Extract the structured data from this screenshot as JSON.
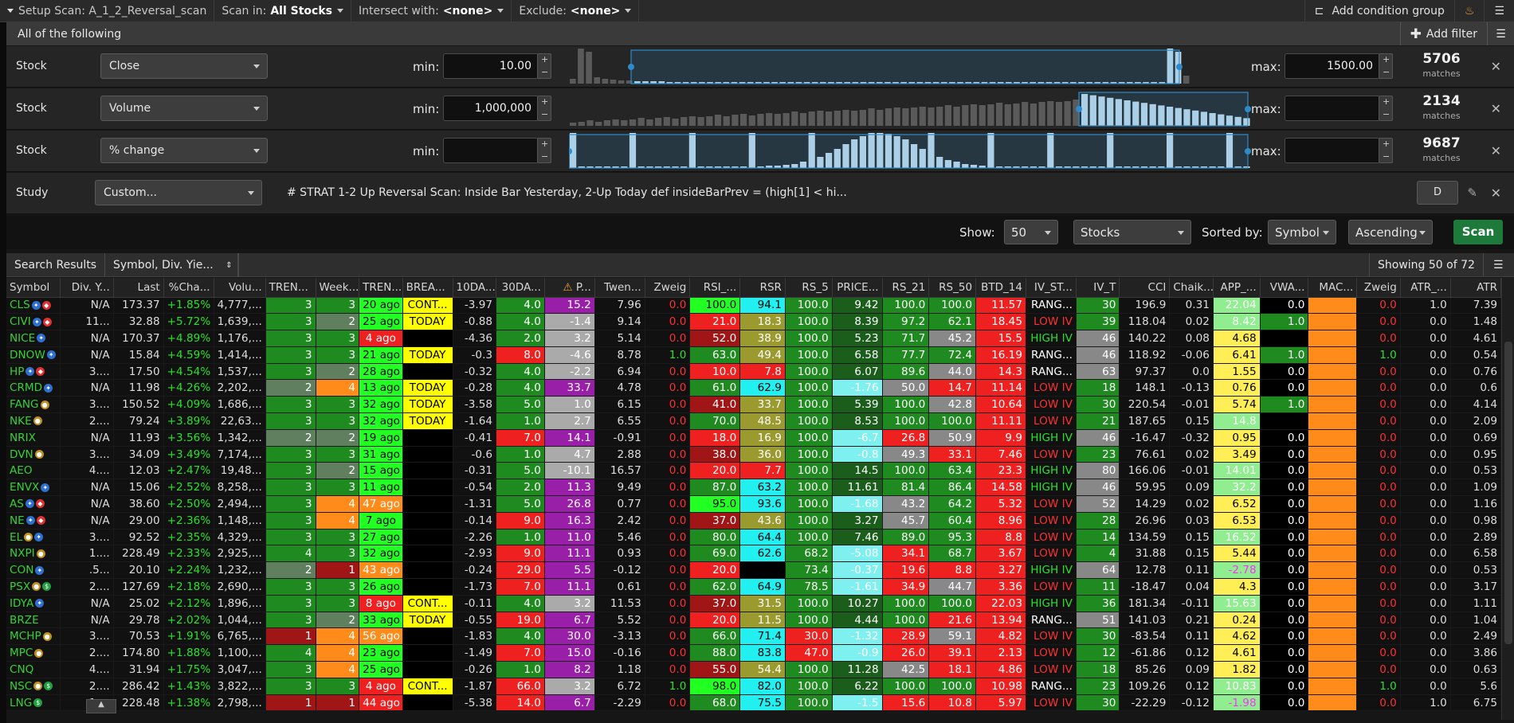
{
  "topbar": {
    "setup_scan": "Setup Scan: A_1_2_Reversal_scan",
    "scan_in_label": "Scan in:",
    "scan_in_value": "All Stocks",
    "intersect_label": "Intersect with:",
    "intersect_value": "<none>",
    "exclude_label": "Exclude:",
    "exclude_value": "<none>",
    "add_condition": "Add condition group"
  },
  "subbar": {
    "title": "All of the following",
    "add_filter": "Add filter"
  },
  "filters": [
    {
      "label": "Stock",
      "field": "Close",
      "min_label": "min:",
      "min": "10.00",
      "max_label": "max:",
      "max": "1500.00",
      "matches": "5706",
      "matches_label": "matches"
    },
    {
      "label": "Stock",
      "field": "Volume",
      "min_label": "min:",
      "min": "1,000,000",
      "max_label": "max:",
      "max": "",
      "matches": "2134",
      "matches_label": "matches"
    },
    {
      "label": "Stock",
      "field": "% change",
      "min_label": "min:",
      "min": "",
      "max_label": "max:",
      "max": "",
      "matches": "9687",
      "matches_label": "matches"
    }
  ],
  "study": {
    "label": "Study",
    "field": "Custom...",
    "code": "# STRAT 1-2 Up Reversal Scan: Inside Bar Yesterday, 2-Up Today  def insideBarPrev = (high[1] < hi...",
    "d_label": "D"
  },
  "showbar": {
    "show_label": "Show:",
    "show_value": "50",
    "type_value": "Stocks",
    "sorted_label": "Sorted by:",
    "sorted_value": "Symbol",
    "order_value": "Ascending",
    "scan_label": "Scan"
  },
  "results": {
    "title": "Search Results",
    "col_set": "Symbol, Div. Yie...",
    "showing": "Showing 50 of 72"
  },
  "columns": [
    "Symbol",
    "Div. Y...",
    "Last",
    "%Cha...",
    "Volu...",
    "TREN...",
    "Week...",
    "TREN...",
    "BREA...",
    "10DA...",
    "30DA...",
    "P...",
    "Twen...",
    "Zweig",
    "RSI_...",
    "RSR",
    "RS_5",
    "PRICE...",
    "RS_21",
    "RS_50",
    "BTD_14",
    "IV_ST...",
    "IV_T",
    "CCI",
    "Chaik...",
    "APP_...",
    "VWA...",
    "MAC...",
    "Zweig",
    "ATR_...",
    "ATR"
  ],
  "rows": [
    [
      "CLS",
      "N/A",
      "173.37",
      "+1.85%",
      "4,777,...",
      "3",
      "3",
      "20 ago",
      "CONT...",
      "-3.97",
      "4.0",
      "15.2",
      "7.96",
      "0.0",
      "100.0",
      "94.1",
      "100.0",
      "9.42",
      "100.0",
      "100.0",
      "11.57",
      "RANG...",
      "30",
      "196.9",
      "0.31",
      "22.04",
      "0.0",
      "",
      "0.0",
      "1.0",
      "7.39"
    ],
    [
      "CIVI",
      "11...",
      "32.88",
      "+5.72%",
      "1,639,...",
      "3",
      "2",
      "25 ago",
      "TODAY",
      "-0.88",
      "4.0",
      "-1.4",
      "9.14",
      "0.0",
      "21.0",
      "18.3",
      "100.0",
      "8.39",
      "97.2",
      "62.1",
      "18.45",
      "LOW IV",
      "39",
      "118.04",
      "0.02",
      "8.42",
      "1.0",
      "",
      "0.0",
      "0.0",
      "1.48"
    ],
    [
      "NICE",
      "N/A",
      "170.37",
      "+4.89%",
      "1,176,...",
      "3",
      "3",
      "4 ago",
      "",
      "-4.36",
      "2.0",
      "3.2",
      "5.14",
      "0.0",
      "52.0",
      "38.9",
      "100.0",
      "5.23",
      "71.7",
      "45.2",
      "15.5",
      "HIGH IV",
      "46",
      "140.22",
      "0.08",
      "4.68",
      "",
      "",
      "0.0",
      "0.0",
      "4.61"
    ],
    [
      "DNOW",
      "N/A",
      "15.84",
      "+4.59%",
      "1,414,...",
      "3",
      "3",
      "21 ago",
      "TODAY",
      "-0.3",
      "8.0",
      "-4.6",
      "8.78",
      "1.0",
      "63.0",
      "49.4",
      "100.0",
      "6.58",
      "77.7",
      "72.4",
      "16.19",
      "RANG...",
      "46",
      "118.92",
      "-0.06",
      "6.41",
      "1.0",
      "",
      "1.0",
      "0.0",
      "0.54"
    ],
    [
      "HP",
      "3....",
      "17.50",
      "+4.54%",
      "1,537,...",
      "3",
      "2",
      "28 ago",
      "",
      "-0.32",
      "4.0",
      "-2.2",
      "6.94",
      "0.0",
      "10.0",
      "7.8",
      "100.0",
      "6.07",
      "89.6",
      "44.0",
      "14.3",
      "RANG...",
      "63",
      "97.37",
      "0.0",
      "1.55",
      "0.0",
      "",
      "0.0",
      "0.0",
      "0.76"
    ],
    [
      "CRMD",
      "N/A",
      "11.98",
      "+4.26%",
      "2,202,...",
      "2",
      "4",
      "13 ago",
      "TODAY",
      "-0.28",
      "4.0",
      "33.7",
      "4.78",
      "0.0",
      "61.0",
      "62.9",
      "100.0",
      "-1.76",
      "50.0",
      "14.7",
      "11.14",
      "LOW IV",
      "18",
      "148.1",
      "-0.13",
      "0.76",
      "0.0",
      "",
      "0.0",
      "0.0",
      "0.6"
    ],
    [
      "FANG",
      "3....",
      "150.52",
      "+4.09%",
      "1,686,...",
      "3",
      "3",
      "32 ago",
      "TODAY",
      "-3.58",
      "5.0",
      "1.0",
      "6.15",
      "0.0",
      "41.0",
      "33.7",
      "100.0",
      "5.39",
      "100.0",
      "42.8",
      "10.64",
      "LOW IV",
      "30",
      "220.54",
      "-0.01",
      "5.74",
      "1.0",
      "",
      "0.0",
      "0.0",
      "4.14"
    ],
    [
      "NKE",
      "2....",
      "79.24",
      "+3.89%",
      "22,63...",
      "3",
      "3",
      "32 ago",
      "TODAY",
      "-1.64",
      "1.0",
      "2.7",
      "6.55",
      "0.0",
      "70.0",
      "48.5",
      "100.0",
      "8.53",
      "100.0",
      "100.0",
      "11.11",
      "LOW IV",
      "21",
      "187.65",
      "0.15",
      "14.8",
      "",
      "",
      "0.0",
      "0.0",
      "2.09"
    ],
    [
      "NRIX",
      "N/A",
      "11.93",
      "+3.56%",
      "1,342,...",
      "2",
      "2",
      "19 ago",
      "",
      "-0.41",
      "7.0",
      "14.1",
      "-0.91",
      "0.0",
      "18.0",
      "16.9",
      "100.0",
      "-6.7",
      "26.8",
      "50.9",
      "9.9",
      "HIGH IV",
      "46",
      "-16.47",
      "-0.32",
      "0.95",
      "0.0",
      "",
      "0.0",
      "0.0",
      "0.69"
    ],
    [
      "DVN",
      "3....",
      "34.09",
      "+3.49%",
      "7,174,...",
      "3",
      "3",
      "31 ago",
      "",
      "-0.6",
      "1.0",
      "4.7",
      "2.88",
      "0.0",
      "38.0",
      "36.0",
      "100.0",
      "-0.8",
      "49.3",
      "33.1",
      "7.46",
      "LOW IV",
      "23",
      "76.61",
      "0.02",
      "3.49",
      "0.0",
      "",
      "0.0",
      "0.0",
      "0.95"
    ],
    [
      "AEO",
      "4....",
      "12.03",
      "+2.47%",
      "19,48...",
      "3",
      "2",
      "15 ago",
      "",
      "-0.31",
      "5.0",
      "-10.1",
      "16.57",
      "0.0",
      "20.0",
      "7.7",
      "100.0",
      "14.5",
      "100.0",
      "63.4",
      "23.3",
      "HIGH IV",
      "80",
      "166.06",
      "-0.01",
      "14.01",
      "0.0",
      "",
      "0.0",
      "0.0",
      "0.53"
    ],
    [
      "ENVX",
      "N/A",
      "15.06",
      "+2.52%",
      "8,258,...",
      "3",
      "3",
      "11 ago",
      "",
      "-0.54",
      "2.0",
      "11.3",
      "9.49",
      "0.0",
      "87.0",
      "63.2",
      "100.0",
      "11.61",
      "81.4",
      "86.4",
      "14.58",
      "HIGH IV",
      "46",
      "59.95",
      "0.09",
      "32.2",
      "0.0",
      "",
      "0.0",
      "0.0",
      "1.09"
    ],
    [
      "AS",
      "N/A",
      "38.60",
      "+2.50%",
      "2,494,...",
      "3",
      "4",
      "47 ago",
      "",
      "-1.31",
      "5.0",
      "26.8",
      "0.77",
      "0.0",
      "95.0",
      "93.6",
      "100.0",
      "-1.68",
      "43.2",
      "64.2",
      "5.32",
      "LOW IV",
      "52",
      "14.29",
      "0.02",
      "6.52",
      "0.0",
      "",
      "0.0",
      "0.0",
      "1.16"
    ],
    [
      "NE",
      "N/A",
      "29.00",
      "+2.36%",
      "1,148,...",
      "3",
      "4",
      "7 ago",
      "",
      "-0.14",
      "9.0",
      "16.3",
      "2.42",
      "0.0",
      "37.0",
      "43.6",
      "100.0",
      "3.27",
      "45.7",
      "60.4",
      "8.96",
      "LOW IV",
      "28",
      "26.96",
      "0.03",
      "6.53",
      "0.0",
      "",
      "0.0",
      "0.0",
      "0.98"
    ],
    [
      "EL",
      "3....",
      "92.52",
      "+2.35%",
      "4,329,...",
      "3",
      "3",
      "27 ago",
      "",
      "-2.26",
      "1.0",
      "11.0",
      "5.46",
      "0.0",
      "80.0",
      "64.4",
      "100.0",
      "7.46",
      "89.0",
      "95.3",
      "8.8",
      "LOW IV",
      "14",
      "134.59",
      "0.15",
      "16.52",
      "0.0",
      "",
      "0.0",
      "0.0",
      "2.89"
    ],
    [
      "NXPI",
      "1....",
      "228.49",
      "+2.33%",
      "2,925,...",
      "4",
      "3",
      "32 ago",
      "",
      "-2.93",
      "9.0",
      "11.1",
      "0.93",
      "0.0",
      "69.0",
      "62.6",
      "68.2",
      "-5.08",
      "34.1",
      "68.7",
      "3.67",
      "LOW IV",
      "4",
      "31.88",
      "0.15",
      "5.44",
      "0.0",
      "",
      "0.0",
      "0.0",
      "6.58"
    ],
    [
      "CON",
      ".5...",
      "20.10",
      "+2.24%",
      "1,232,...",
      "2",
      "1",
      "43 ago",
      "",
      "-0.24",
      "29.0",
      "5.5",
      "-0.12",
      "0.0",
      "20.0",
      "",
      "73.4",
      "-0.37",
      "19.6",
      "8.8",
      "3.27",
      "HIGH IV",
      "64",
      "12.78",
      "0.11",
      "-2.78",
      "0.0",
      "",
      "0.0",
      "0.0",
      "0.53"
    ],
    [
      "PSX",
      "2....",
      "127.69",
      "+2.18%",
      "2,690,...",
      "3",
      "3",
      "26 ago",
      "",
      "-1.73",
      "7.0",
      "11.1",
      "0.61",
      "0.0",
      "62.0",
      "64.9",
      "78.5",
      "-1.61",
      "34.9",
      "44.7",
      "3.36",
      "LOW IV",
      "11",
      "-18.47",
      "0.04",
      "4.3",
      "0.0",
      "",
      "0.0",
      "0.0",
      "3.17"
    ],
    [
      "IDYA",
      "N/A",
      "25.02",
      "+2.12%",
      "1,896,...",
      "3",
      "3",
      "8 ago",
      "CONT...",
      "-0.11",
      "4.0",
      "3.2",
      "11.53",
      "0.0",
      "37.0",
      "31.5",
      "100.0",
      "10.27",
      "100.0",
      "100.0",
      "22.03",
      "HIGH IV",
      "36",
      "181.34",
      "-0.11",
      "15.63",
      "0.0",
      "",
      "0.0",
      "0.0",
      "1.11"
    ],
    [
      "BRZE",
      "N/A",
      "29.78",
      "+2.02%",
      "1,044,...",
      "3",
      "2",
      "33 ago",
      "TODAY",
      "-0.55",
      "19.0",
      "6.7",
      "5.52",
      "0.0",
      "20.0",
      "11.5",
      "100.0",
      "4.44",
      "100.0",
      "21.6",
      "13.94",
      "RANG...",
      "51",
      "141.03",
      "0.21",
      "0.24",
      "0.0",
      "",
      "0.0",
      "0.0",
      "1.04"
    ],
    [
      "MCHP",
      "3....",
      "70.53",
      "+1.91%",
      "6,765,...",
      "1",
      "4",
      "56 ago",
      "",
      "-1.83",
      "4.0",
      "30.0",
      "-3.13",
      "0.0",
      "66.0",
      "71.4",
      "30.0",
      "-1.32",
      "28.9",
      "59.1",
      "4.82",
      "LOW IV",
      "30",
      "-83.54",
      "0.11",
      "4.62",
      "0.0",
      "",
      "0.0",
      "0.0",
      "2.49"
    ],
    [
      "MPC",
      "2....",
      "174.80",
      "+1.88%",
      "1,100,...",
      "4",
      "4",
      "23 ago",
      "",
      "-1.49",
      "7.0",
      "15.0",
      "-0.16",
      "0.0",
      "88.0",
      "83.8",
      "47.0",
      "-0.9",
      "26.0",
      "39.1",
      "2.13",
      "LOW IV",
      "12",
      "-61.86",
      "0.12",
      "4.61",
      "0.0",
      "",
      "0.0",
      "0.0",
      "3.86"
    ],
    [
      "CNQ",
      "4....",
      "31.94",
      "+1.75%",
      "3,047,...",
      "3",
      "4",
      "25 ago",
      "",
      "-0.26",
      "1.0",
      "8.2",
      "1.18",
      "0.0",
      "55.0",
      "54.4",
      "100.0",
      "11.28",
      "42.5",
      "18.1",
      "4.86",
      "LOW IV",
      "18",
      "85.26",
      "0.09",
      "1.82",
      "0.0",
      "",
      "0.0",
      "0.0",
      "0.63"
    ],
    [
      "NSC",
      "2....",
      "286.42",
      "+1.43%",
      "3,822,...",
      "3",
      "3",
      "4 ago",
      "CONT...",
      "-1.87",
      "66.0",
      "3.2",
      "6.72",
      "1.0",
      "98.0",
      "82.0",
      "100.0",
      "6.22",
      "100.0",
      "100.0",
      "10.98",
      "RANG...",
      "23",
      "109.26",
      "0.12",
      "10.83",
      "0.0",
      "",
      "1.0",
      "0.0",
      "5.6"
    ],
    [
      "LNG",
      "1....",
      "228.48",
      "+1.38%",
      "2,798,...",
      "1",
      "1",
      "44 ago",
      "",
      "-5.38",
      "14.0",
      "6.7",
      "-2.29",
      "0.0",
      "68.0",
      "75.5",
      "100.0",
      "-1.5",
      "15.6",
      "10.8",
      "5.97",
      "LOW IV",
      "30",
      "-22.29",
      "-0.12",
      "-1.98",
      "0.0",
      "",
      "0.0",
      "1.0",
      "6.75"
    ]
  ],
  "row_badges": [
    [
      "b",
      "r"
    ],
    [
      "b",
      "r"
    ],
    [
      "b"
    ],
    [
      "b"
    ],
    [
      "b",
      "r"
    ],
    [
      "b"
    ],
    [
      "o"
    ],
    [
      "o"
    ],
    [],
    [
      "o"
    ],
    [],
    [
      "b"
    ],
    [
      "b",
      "r"
    ],
    [
      "b",
      "r"
    ],
    [
      "o",
      "b"
    ],
    [
      "o"
    ],
    [
      "b"
    ],
    [
      "o",
      "g"
    ],
    [
      "b"
    ],
    [],
    [
      "o"
    ],
    [
      "o"
    ],
    [],
    [
      "o",
      "g"
    ],
    [
      "g"
    ]
  ]
}
